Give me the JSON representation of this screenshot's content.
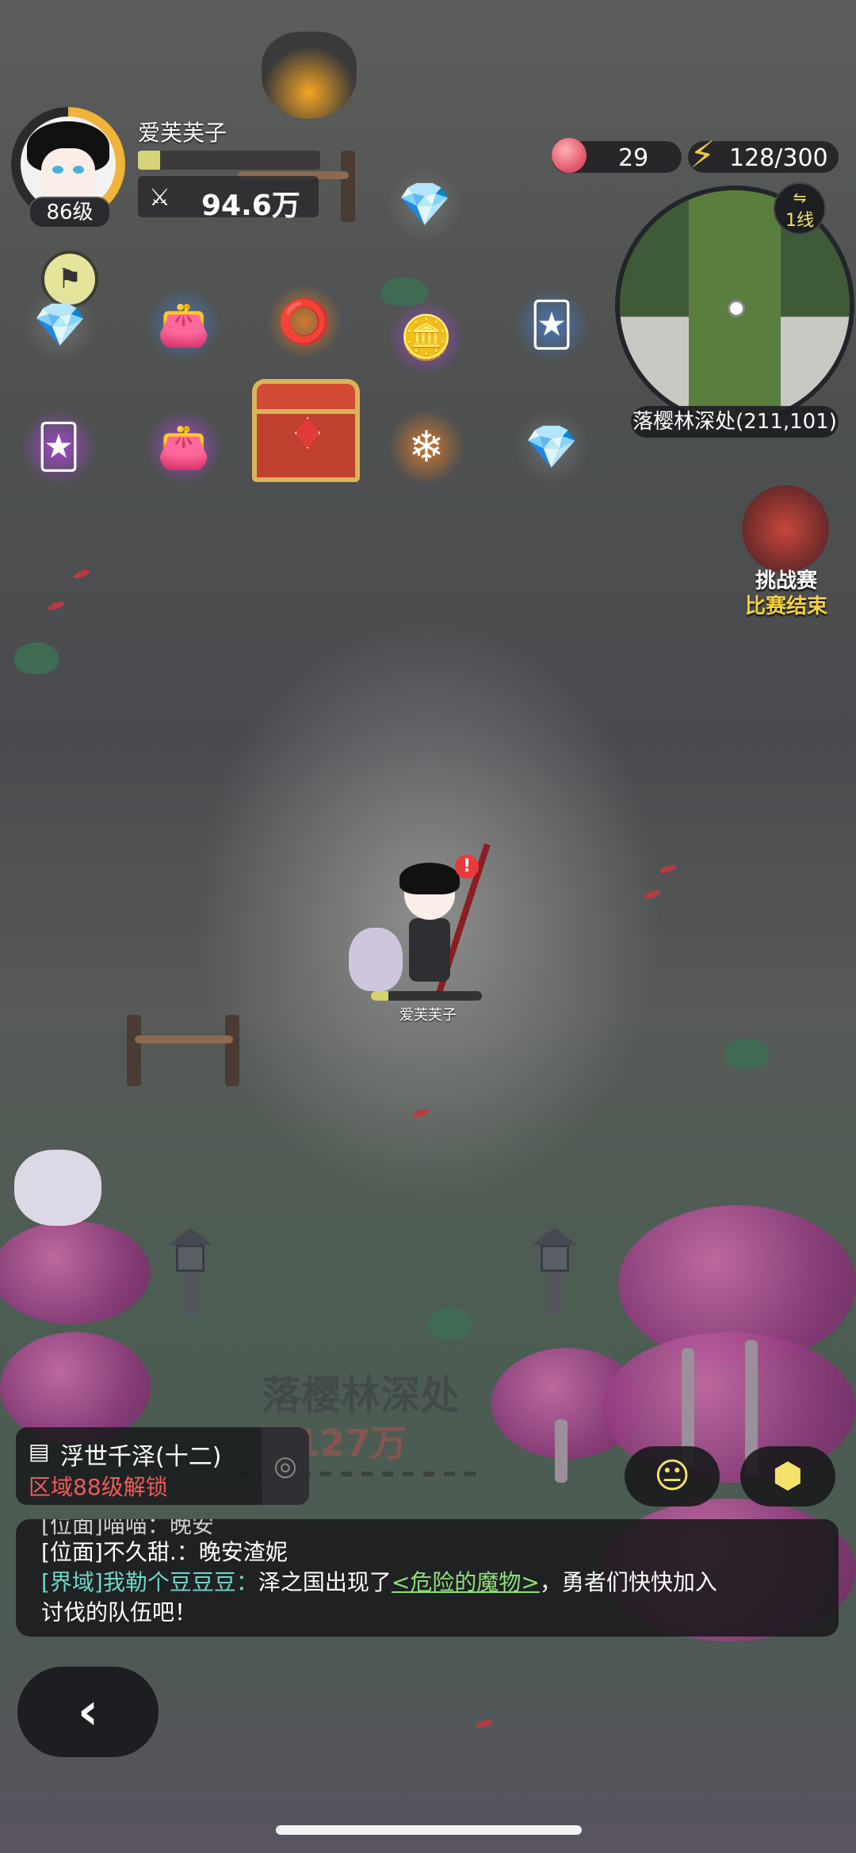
{
  "player": {
    "name": "爱芙芙子",
    "level_label": "86级",
    "exp_fraction": 0.12,
    "power_icon": "crossed-swords-icon",
    "power_value": "94.6万"
  },
  "currencies": [
    {
      "icon": "peach-icon",
      "value": "29"
    },
    {
      "icon": "lightning-icon",
      "value": "128/300"
    }
  ],
  "minimap": {
    "line_label": "1线",
    "location_label": "落樱林深处(211,101)"
  },
  "loot_items": [
    {
      "icon": "crystal-ore-icon"
    },
    {
      "icon": "paw-pouch-icon"
    },
    {
      "icon": "dark-ring-icon"
    },
    {
      "icon": "gold-ingots-icon"
    },
    {
      "icon": "blue-card-icon"
    },
    {
      "icon": "purple-card-icon"
    },
    {
      "icon": "pink-pouch-icon"
    },
    {
      "icon": "treasure-chest-icon"
    },
    {
      "icon": "ice-star-icon"
    },
    {
      "icon": "crystal-ore-icon"
    },
    {
      "icon": "crystal-ore-icon"
    }
  ],
  "challenge": {
    "title": "挑战赛",
    "status": "比赛结束"
  },
  "hero": {
    "name": "爱芙芙子",
    "hp_fraction": 0.16,
    "alert": "!"
  },
  "area": {
    "name": "落樱林深处",
    "power": "127万"
  },
  "quest": {
    "title": "浮世千泽(十二)",
    "subtitle": "区域88级解锁"
  },
  "chat": {
    "partial_line": "[位面]喵喵：晚安",
    "line1_tag": "[位面]",
    "line1_text": "不久甜.：晚安渣妮",
    "line2_tag": "[界域]",
    "line2_name": "我勒个豆豆豆：",
    "line2_text": "泽之国出现了",
    "line2_link": "<危险的魔物>",
    "line2_after": "，勇者们快快加入",
    "line3_text": "讨伐的队伍吧！"
  },
  "colors": {
    "accent_yellow": "#f4e36a",
    "alert_red": "#f05a5a",
    "chat_tag": "#6ed6c8",
    "chat_link": "#8ee07a"
  }
}
